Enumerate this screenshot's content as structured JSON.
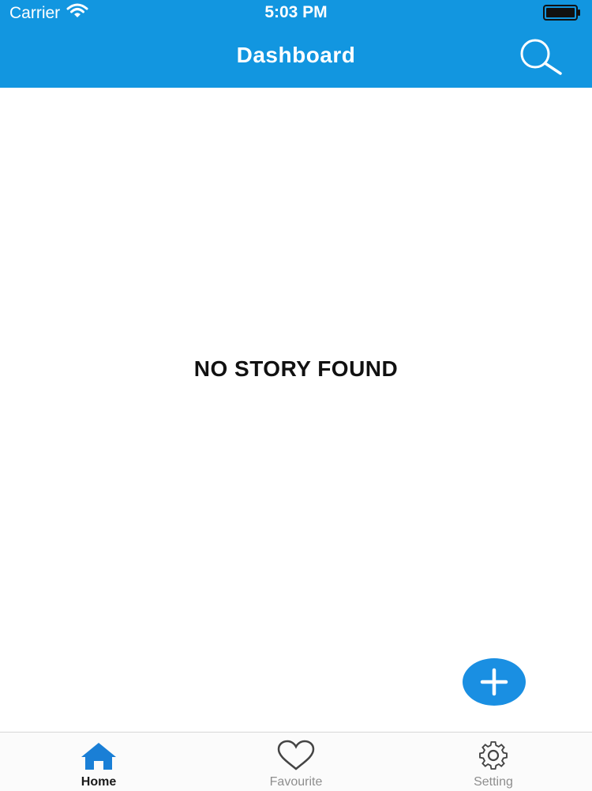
{
  "status_bar": {
    "carrier": "Carrier",
    "time": "5:03 PM",
    "wifi_icon": "wifi-icon",
    "battery_icon": "battery-icon"
  },
  "nav_bar": {
    "title": "Dashboard",
    "search_icon": "search-icon"
  },
  "main": {
    "empty_message": "NO STORY FOUND",
    "fab_icon": "plus-icon"
  },
  "tabs": [
    {
      "label": "Home",
      "icon": "home-icon",
      "active": true
    },
    {
      "label": "Favourite",
      "icon": "heart-icon",
      "active": false
    },
    {
      "label": "Setting",
      "icon": "gear-icon",
      "active": false
    }
  ],
  "colors": {
    "accent": "#1296e0",
    "fab": "#1a8fe2",
    "active_tab_icon": "#1a7fd6",
    "inactive_tab": "#8e8e8e"
  }
}
